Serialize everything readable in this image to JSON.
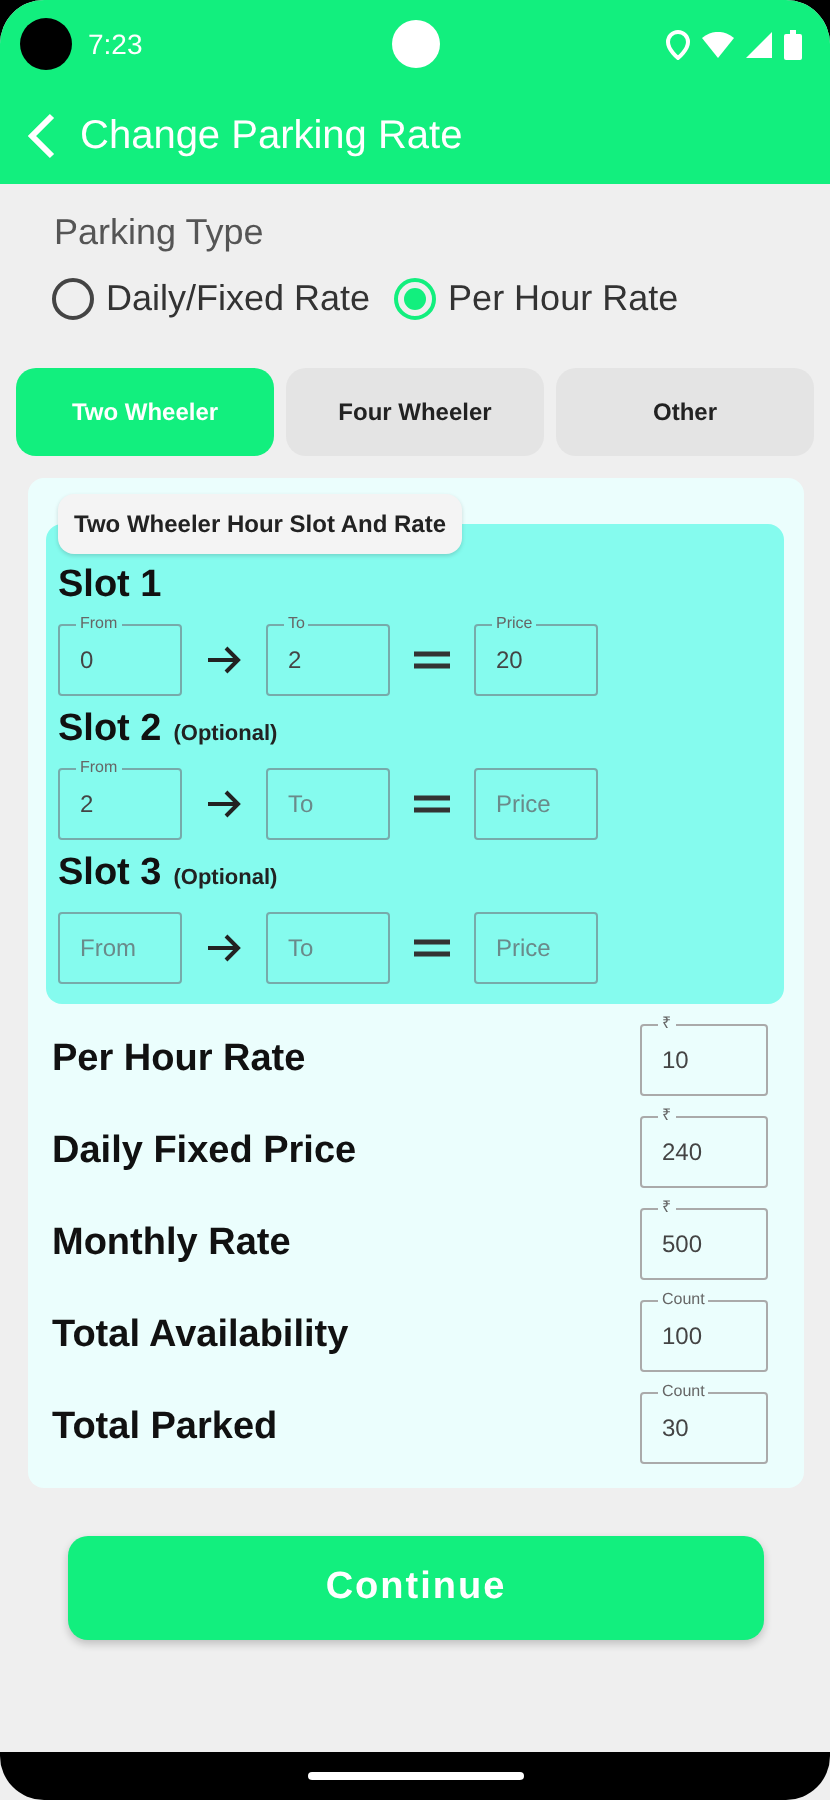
{
  "status_bar": {
    "time": "7:23"
  },
  "header": {
    "title": "Change Parking Rate"
  },
  "parking_type": {
    "label": "Parking Type",
    "options": [
      {
        "label": "Daily/Fixed Rate",
        "selected": false
      },
      {
        "label": "Per Hour Rate",
        "selected": true
      }
    ]
  },
  "tabs": [
    {
      "label": "Two Wheeler",
      "selected": true
    },
    {
      "label": "Four Wheeler",
      "selected": false
    },
    {
      "label": "Other",
      "selected": false
    }
  ],
  "slot_card": {
    "title": "Two Wheeler Hour Slot And Rate",
    "slots": [
      {
        "label": "Slot 1",
        "from": {
          "label": "From",
          "value": "0"
        },
        "to": {
          "label": "To",
          "value": "2"
        },
        "price": {
          "label": "Price",
          "value": "20"
        }
      },
      {
        "label": "Slot 2",
        "note": "(Optional)",
        "from": {
          "label": "From",
          "value": "2"
        },
        "to": {
          "placeholder": "To"
        },
        "price": {
          "placeholder": "Price"
        }
      },
      {
        "label": "Slot 3",
        "note": "(Optional)",
        "from": {
          "placeholder": "From"
        },
        "to": {
          "placeholder": "To"
        },
        "price": {
          "placeholder": "Price"
        }
      }
    ]
  },
  "rates": [
    {
      "label": "Per Hour Rate",
      "field": {
        "label": "₹",
        "value": "10"
      }
    },
    {
      "label": "Daily Fixed Price",
      "field": {
        "label": "₹",
        "value": "240"
      }
    },
    {
      "label": "Monthly Rate",
      "field": {
        "label": "₹",
        "value": "500"
      }
    },
    {
      "label": "Total Availability",
      "field": {
        "label": "Count",
        "value": "100"
      }
    },
    {
      "label": "Total Parked",
      "field": {
        "label": "Count",
        "value": "30"
      }
    }
  ],
  "continue_button": "Continue"
}
